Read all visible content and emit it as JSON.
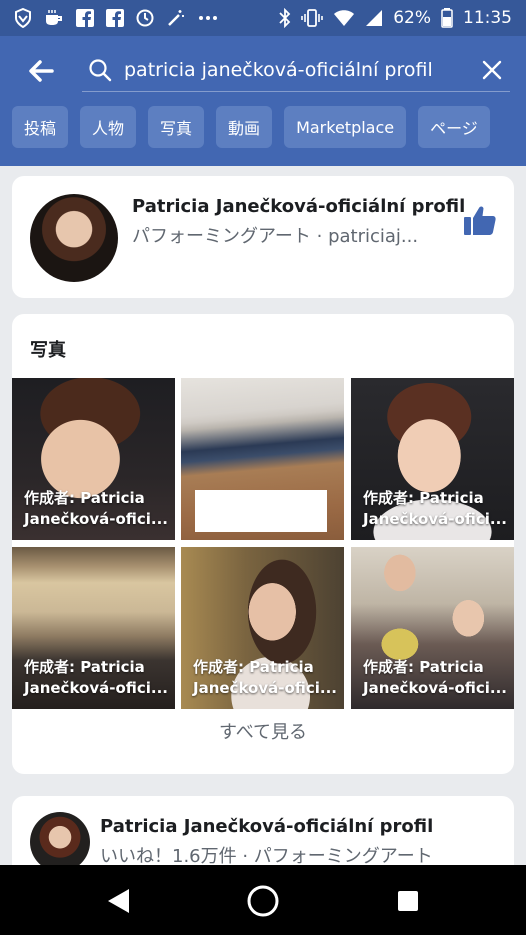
{
  "status_bar": {
    "battery": "62%",
    "time": "11:35",
    "left_icons": [
      "shield-icon",
      "cup-icon",
      "facebook-icon",
      "facebook-icon",
      "clock-icon",
      "wand-icon",
      "more-icon"
    ],
    "right_icons": [
      "bluetooth-icon",
      "vibrate-icon",
      "wifi-icon",
      "signal-icon",
      "battery-icon"
    ]
  },
  "search": {
    "query": "patricia janečková-oficiální profil"
  },
  "filters": [
    "投稿",
    "人物",
    "写真",
    "動画",
    "Marketplace",
    "ページ"
  ],
  "colors": {
    "header": "#4267b2",
    "statusbar": "#365899",
    "chip": "#5d7fc1",
    "like": "#4267b2"
  },
  "page_result": {
    "title": "Patricia Janečková-oficiální profil",
    "subtitle": "パフォーミングアート · patriciaj..."
  },
  "photos_section": {
    "title": "写真",
    "items": [
      {
        "caption": "作成者: Patricia Janečková-ofici..."
      },
      {
        "caption": ""
      },
      {
        "caption": "作成者: Patricia Janečková-ofici..."
      },
      {
        "caption": "作成者: Patricia Janečková-ofici..."
      },
      {
        "caption": "作成者: Patricia Janečková-ofici..."
      },
      {
        "caption": "作成者: Patricia Janečková-ofici..."
      }
    ],
    "see_all": "すべて見る"
  },
  "second_result": {
    "title": "Patricia Janečková-oficiální profil",
    "subtitle": "いいね！1.6万件 · パフォーミングアート"
  }
}
